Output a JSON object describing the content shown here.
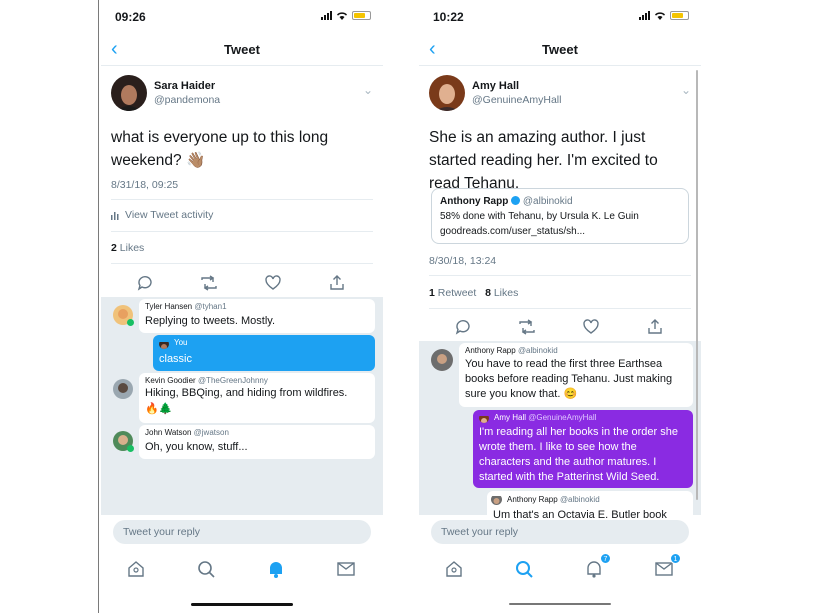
{
  "left": {
    "status": {
      "time": "09:26"
    },
    "nav": {
      "title": "Tweet"
    },
    "author": {
      "name": "Sara Haider",
      "handle": "@pandemona"
    },
    "tweet": {
      "text": "what is everyone up to this long weekend? 👋🏽",
      "timestamp": "8/31/18, 09:25"
    },
    "activity_label": "View Tweet activity",
    "likes": {
      "count": "2",
      "label": "Likes"
    },
    "dm": [
      {
        "name": "Tyler Hansen",
        "handle": "@tyhan1",
        "text": "Replying to tweets. Mostly."
      },
      {
        "name": "You",
        "handle": "",
        "text": "classic"
      },
      {
        "name": "Kevin Goodier",
        "handle": "@TheGreenJohnny",
        "text": "Hiking, BBQing, and hiding from wildfires.",
        "text2": "🔥🌲"
      },
      {
        "name": "John Watson",
        "handle": "@jwatson",
        "text": "Oh, you know, stuff..."
      }
    ],
    "reply_placeholder": "Tweet your reply"
  },
  "right": {
    "status": {
      "time": "10:22"
    },
    "nav": {
      "title": "Tweet"
    },
    "author": {
      "name": "Amy Hall",
      "handle": "@GenuineAmyHall"
    },
    "tweet": {
      "text": "She is an amazing author. I just started reading her.  I'm excited to read Tehanu.",
      "timestamp": "8/30/18, 13:24"
    },
    "quote": {
      "name": "Anthony Rapp",
      "handle": "@albinokid",
      "line1": "58% done with Tehanu, by Ursula K. Le Guin",
      "line2": "goodreads.com/user_status/sh..."
    },
    "stats": {
      "retweets": "1",
      "retweet_label": "Retweet",
      "likes": "8",
      "likes_label": "Likes"
    },
    "dm": [
      {
        "name": "Anthony Rapp",
        "handle": "@albinokid",
        "line1": "You have to read the first three Earthsea",
        "line2": "books before reading Tehanu. Just making",
        "line3": "sure you know that. 😊"
      },
      {
        "name": "Amy Hall",
        "handle": "@GenuineAmyHall",
        "line1": "I'm reading all her books in the order she",
        "line2": "wrote them.  I like to see how the",
        "line3": "characters and the author matures.  I",
        "line4": "started with the Patterinst Wild Seed."
      },
      {
        "name": "Anthony Rapp",
        "handle": "@albinokid",
        "line1": "Um that's an Octavia E. Butler book"
      }
    ],
    "reply_placeholder": "Tweet your reply",
    "badges": {
      "notifications": "7",
      "messages": "1"
    }
  },
  "colors": {
    "accent": "#1da1f2",
    "purple": "#8a2be2",
    "dm_bg": "#e6ecf0"
  }
}
